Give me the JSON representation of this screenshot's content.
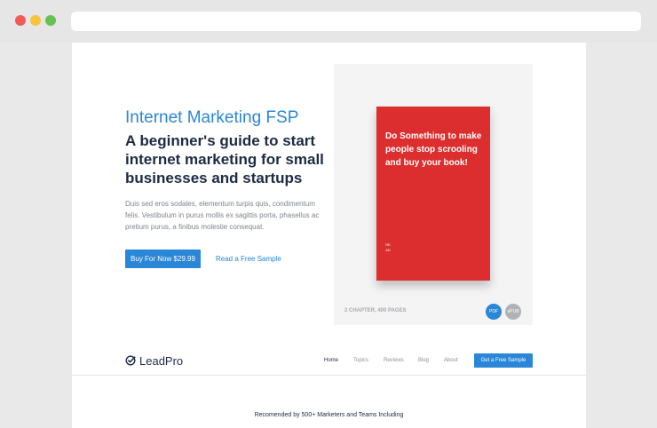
{
  "hero": {
    "title": "Internet Marketing FSP",
    "headline": "A beginner's guide to start internet marketing for small businesses and startups",
    "description": "Duis sed eros sodales, elementum turpis quis, condimentum felis. Vestibulum in purus mollis ex sagittis porta, phasellus ac pretium purus, a finibus molestie consequat.",
    "buy_button": "Buy For Now $29.99",
    "sample_link": "Read a Free Sample"
  },
  "book": {
    "cover_text": "Do Something to make people stop scrooling and buy your book!",
    "spine_text": "READ",
    "meta": "2 CHAPTER, 400 PAGES",
    "formats": [
      "PDF",
      "ePUB"
    ],
    "cover_color": "#dc2e2e"
  },
  "navbar": {
    "logo_icon": "check-circle-icon",
    "logo_text": "LeadPro",
    "items": [
      "Home",
      "Topics",
      "Reviews",
      "Blog",
      "About"
    ],
    "active_item": "Home",
    "cta_button": "Get a Free Sample"
  },
  "recommend_text": "Recomended by 500+ Marketers and Teams Including",
  "colors": {
    "accent": "#2a86d7",
    "heading": "#1d2b43",
    "body_text": "#7d848c"
  }
}
